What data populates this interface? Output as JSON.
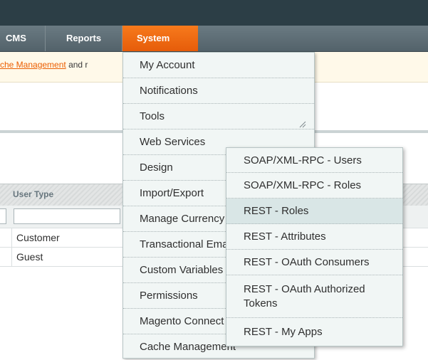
{
  "nav": {
    "cms": "CMS",
    "reports": "Reports",
    "system": "System"
  },
  "notice": {
    "link_text": "che Management",
    "trailing_text": " and r"
  },
  "grid": {
    "column_header": "User Type",
    "filter_value": "",
    "rows": [
      "Customer",
      "Guest"
    ]
  },
  "system_menu": {
    "items": [
      "My Account",
      "Notifications",
      "Tools",
      "Web Services",
      "Design",
      "Import/Export",
      "Manage Currency",
      "Transactional Emails",
      "Custom Variables",
      "Permissions",
      "Magento Connect",
      "Cache Management"
    ]
  },
  "web_services_submenu": {
    "items": [
      "SOAP/XML-RPC - Users",
      "SOAP/XML-RPC - Roles",
      "REST - Roles",
      "REST - Attributes",
      "REST - OAuth Consumers",
      "REST - OAuth Authorized Tokens",
      "REST - My Apps"
    ],
    "active_item": "REST - Roles"
  },
  "colors": {
    "accent": "#e65c0a",
    "link": "#eb5e00",
    "menu_bg": "#f1f6f5",
    "active_bg": "#d9e6e6"
  }
}
